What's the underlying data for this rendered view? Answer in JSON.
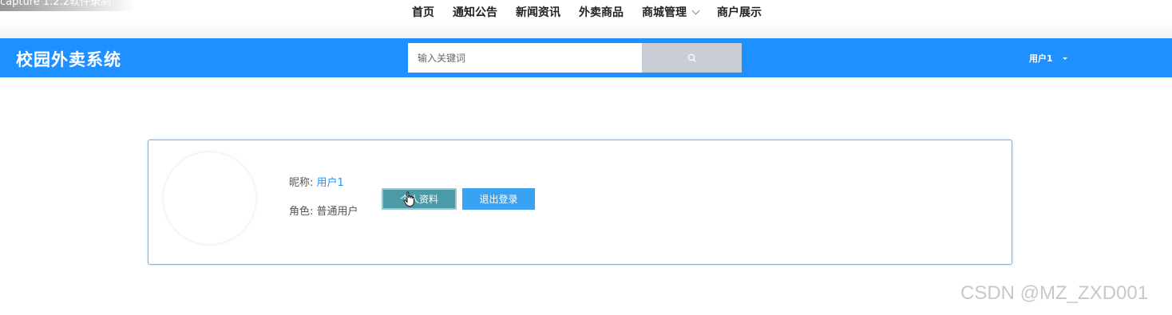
{
  "capture_label": "capture 1.2.2软件录制",
  "nav": {
    "items": [
      {
        "label": "首页"
      },
      {
        "label": "通知公告"
      },
      {
        "label": "新闻资讯"
      },
      {
        "label": "外卖商品"
      },
      {
        "label": "商城管理",
        "has_dropdown": true
      },
      {
        "label": "商户展示"
      }
    ]
  },
  "header": {
    "logo": "校园外卖系统",
    "search": {
      "placeholder": "输入关键词",
      "value": ""
    },
    "user_menu": {
      "label": "用户1"
    }
  },
  "colors": {
    "header_bg": "#1e90ff",
    "primary_button": "#3aa2f2",
    "active_button": "#4a9aa8",
    "search_button_bg": "#c9ced6"
  },
  "profile": {
    "nickname_label": "昵称: ",
    "nickname_value": "用户1",
    "role_label": "角色: ",
    "role_value": "普通用户",
    "profile_button": "个人资料",
    "logout_button": "退出登录"
  },
  "watermark": "CSDN @MZ_ZXD001"
}
